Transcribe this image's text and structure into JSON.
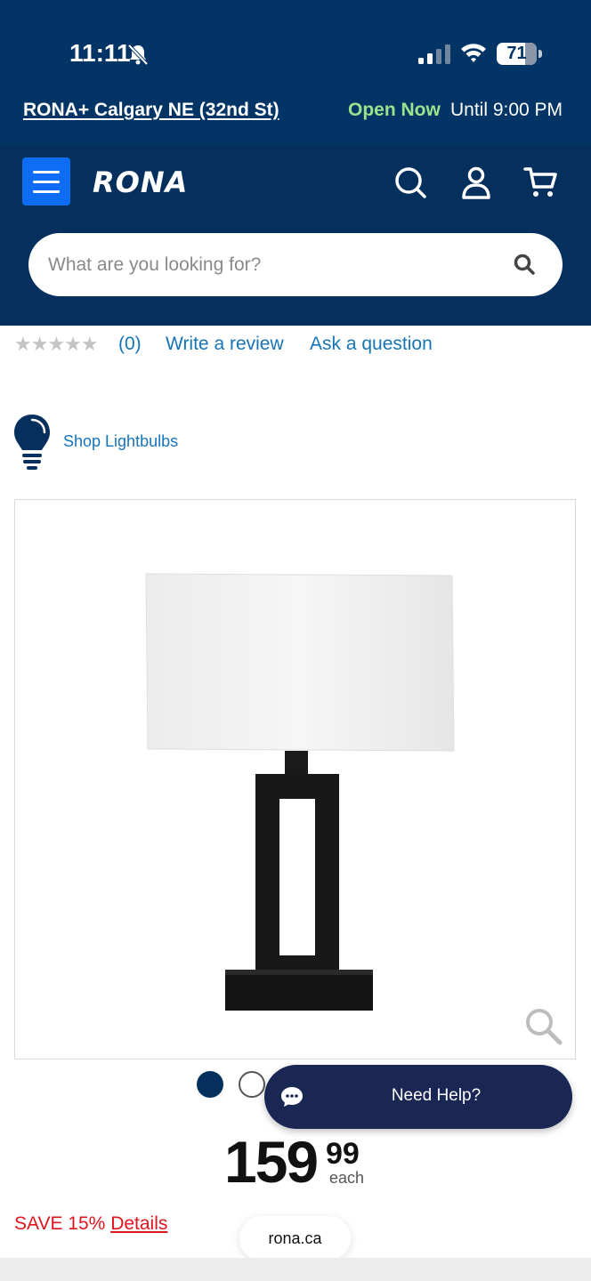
{
  "status_bar": {
    "time": "11:11",
    "battery": "71",
    "battery_level": 0.71
  },
  "store": {
    "name": "RONA+ Calgary NE (32nd St)",
    "status": "Open Now",
    "hours": "Until 9:00 PM"
  },
  "header": {
    "logo": "RONA",
    "search_placeholder": "What are you looking for?"
  },
  "reviews": {
    "stars": "★★★★★",
    "rating": 0,
    "count": "(0)",
    "write_review": "Write a review",
    "ask_question": "Ask a question"
  },
  "lightbulbs": {
    "label": "Shop Lightbulbs"
  },
  "carousel": {
    "total_visible_dots": 2,
    "active_index": 0
  },
  "help": {
    "label": "Need Help?"
  },
  "price": {
    "dollars": "159",
    "cents": "99",
    "unit": "each"
  },
  "promo": {
    "save": "SAVE 15%",
    "details": "Details"
  },
  "browser": {
    "url": "rona.ca"
  },
  "colors": {
    "header_bg": "#05305d",
    "menu_button": "#0f6cf5",
    "link": "#1674b8",
    "open_now": "#9be38c",
    "promo_red": "#e0141e",
    "help_bg": "#1a2654"
  }
}
